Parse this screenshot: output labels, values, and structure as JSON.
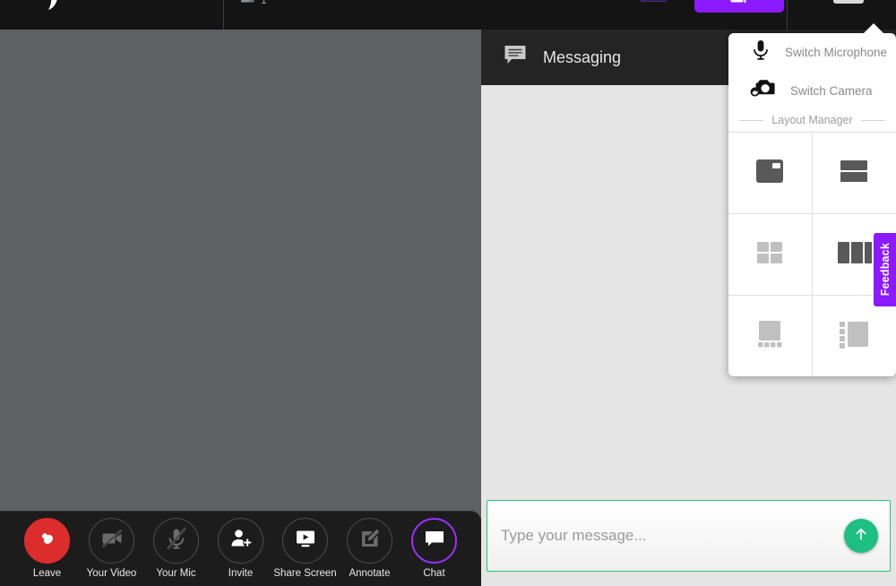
{
  "topbar": {
    "logo_icon": "app-logo-icon",
    "participants_icon": "participants-icon",
    "participants_count": "1",
    "record_button_label": "",
    "primary_button_icon": "screen-share-icon",
    "settings_button_icon": "settings-menu-icon"
  },
  "stage": {
    "background_color": "#5f6062"
  },
  "controls": {
    "items": [
      {
        "id": "leave",
        "label": "Leave",
        "icon": "phone-hangup-icon",
        "style": "danger"
      },
      {
        "id": "your-video",
        "label": "Your Video",
        "icon": "camera-off-icon",
        "style": "muted"
      },
      {
        "id": "your-mic",
        "label": "Your Mic",
        "icon": "microphone-off-icon",
        "style": "muted"
      },
      {
        "id": "invite",
        "label": "Invite",
        "icon": "person-add-icon",
        "style": "normal"
      },
      {
        "id": "share-screen",
        "label": "Share Screen",
        "icon": "monitor-share-icon",
        "style": "normal"
      },
      {
        "id": "annotate",
        "label": "Annotate",
        "icon": "pencil-square-icon",
        "style": "muted"
      },
      {
        "id": "chat",
        "label": "Chat",
        "icon": "chat-bubble-icon",
        "style": "active"
      }
    ],
    "active_accent": "#9b30ff",
    "leave_color": "#dd2c2c"
  },
  "chat": {
    "header_title": "Messaging",
    "header_icon": "chat-bubble-icon",
    "messages": [],
    "compose": {
      "value": "",
      "placeholder": "Type your message...",
      "send_icon": "arrow-up-icon",
      "send_color": "#1dbf82",
      "border_color": "#29c27e"
    }
  },
  "settings_popup": {
    "items": [
      {
        "id": "switch-microphone",
        "label": "Switch Microphone",
        "icon": "microphone-icon"
      },
      {
        "id": "switch-camera",
        "label": "Switch Camera",
        "icon": "camera-switch-icon"
      }
    ],
    "section_label": "Layout Manager",
    "layouts": [
      {
        "id": "picture-in-picture",
        "icon": "layout-pip-icon",
        "state": "selected"
      },
      {
        "id": "stacked",
        "icon": "layout-stacked-icon",
        "state": "selected"
      },
      {
        "id": "grid",
        "icon": "layout-grid-icon",
        "state": "normal"
      },
      {
        "id": "side-by-side",
        "icon": "layout-columns-icon",
        "state": "selected"
      },
      {
        "id": "filmstrip-bottom",
        "icon": "layout-filmstrip-bottom-icon",
        "state": "normal"
      },
      {
        "id": "sidebar-left",
        "icon": "layout-sidebar-left-icon",
        "state": "normal"
      }
    ]
  },
  "feedback": {
    "label": "Feedback",
    "color": "#8c1aff"
  }
}
